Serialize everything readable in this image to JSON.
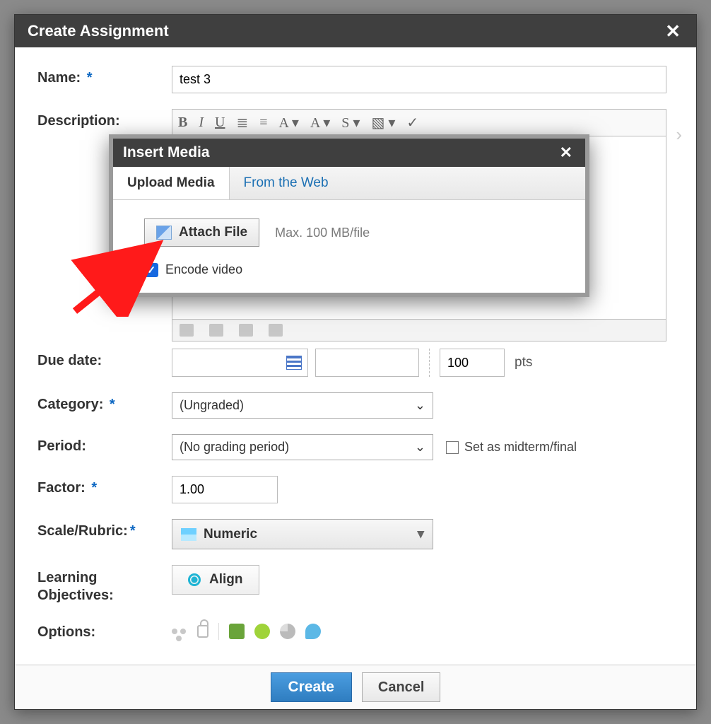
{
  "dialog": {
    "title": "Create Assignment"
  },
  "form": {
    "name_label": "Name:",
    "name_value": "test 3",
    "description_label": "Description:",
    "due_date_label": "Due date:",
    "points_value": "100",
    "points_unit": "pts",
    "category_label": "Category:",
    "category_value": "(Ungraded)",
    "period_label": "Period:",
    "period_value": "(No grading period)",
    "midterm_label": "Set as midterm/final",
    "factor_label": "Factor:",
    "factor_value": "1.00",
    "scale_label": "Scale/Rubric:",
    "scale_value": "Numeric",
    "objectives_label": "Learning Objectives:",
    "align_label": "Align",
    "options_label": "Options:"
  },
  "media": {
    "title": "Insert Media",
    "tab_upload": "Upload Media",
    "tab_web": "From the Web",
    "attach_label": "Attach File",
    "max_note": "Max. 100 MB/file",
    "encode_label": "Encode video"
  },
  "footer": {
    "create": "Create",
    "cancel": "Cancel"
  }
}
